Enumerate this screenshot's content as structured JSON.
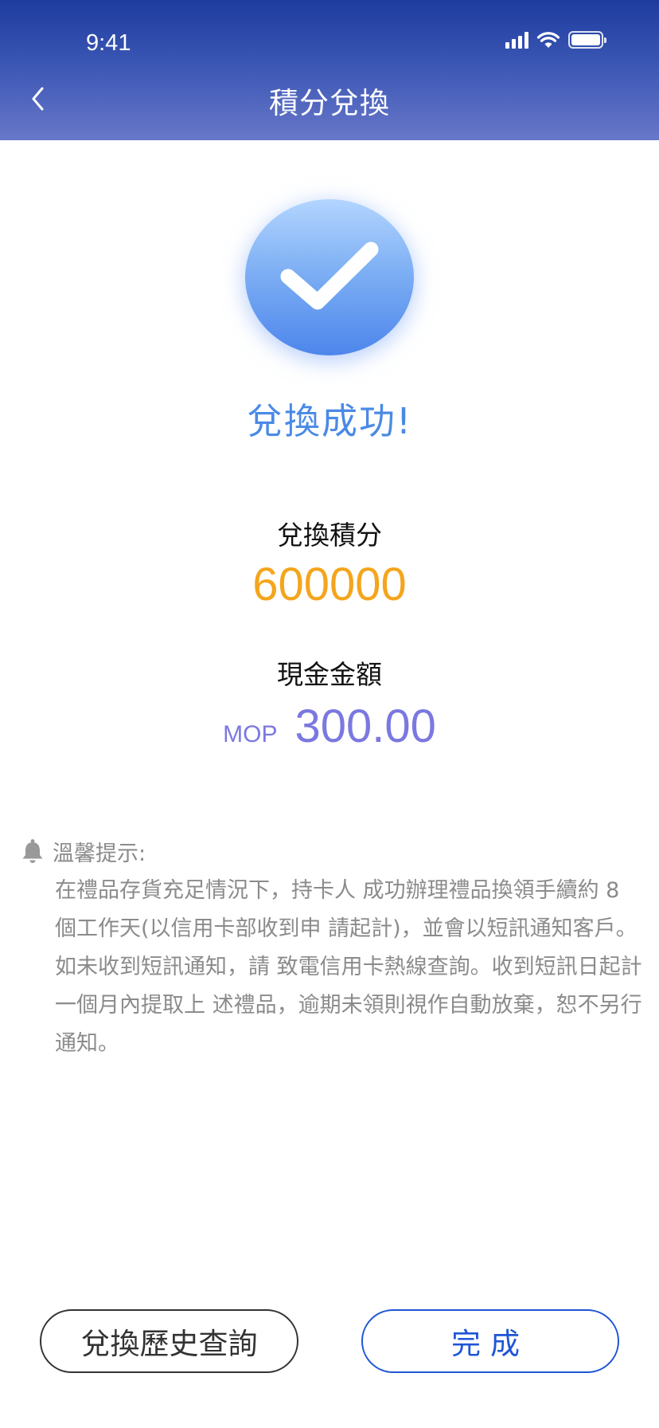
{
  "status_bar": {
    "time": "9:41",
    "icons": [
      "signal-icon",
      "wifi-icon",
      "battery-icon"
    ]
  },
  "nav": {
    "title": "積分兌換",
    "back_icon": "chevron-left-icon"
  },
  "result": {
    "icon": "checkmark-icon",
    "title": "兌換成功!"
  },
  "points": {
    "label": "兌換積分",
    "value": "600000"
  },
  "cash": {
    "label": "現金金額",
    "currency": "MOP",
    "value": "300.00"
  },
  "tip": {
    "icon": "bell-icon",
    "title": "溫馨提示:",
    "body": "在禮品存貨充足情況下，持卡人 成功辦理禮品換領手續約 8 個工作天(以信用卡部收到申 請起計)，並會以短訊通知客戶。如未收到短訊通知，請 致電信用卡熱線查詢。收到短訊日起計一個月內提取上 述禮品，逾期未領則視作自動放棄，恕不另行通知。"
  },
  "buttons": {
    "history": "兌換歷史查詢",
    "done": "完成"
  },
  "colors": {
    "header_top": "#1e3c9e",
    "header_bottom": "#6877c9",
    "success": "#4a8ae6",
    "points": "#f4a51c",
    "cash": "#7b78e0",
    "done_button": "#1f56d6"
  }
}
